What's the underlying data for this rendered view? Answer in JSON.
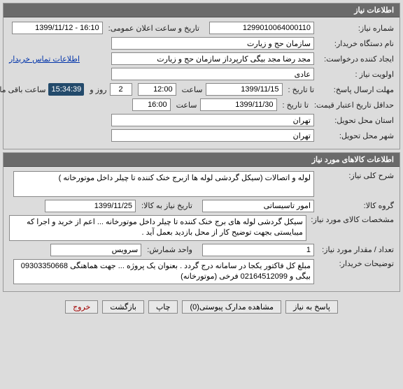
{
  "panel1": {
    "title": "اطلاعات نیاز",
    "need_no_label": "شماره نیاز:",
    "need_no": "1299010064000110",
    "announce_label": "تاریخ و ساعت اعلان عمومی:",
    "announce_val": "16:10 - 1399/11/12",
    "org_label": "نام دستگاه خریدار:",
    "org_val": "سازمان حج و زیارت",
    "creator_label": "ایجاد کننده درخواست:",
    "creator_val": "مجد رضا مجد بیگی کارپرداز سازمان حج و زیارت",
    "contact_link": "اطلاعات تماس خریدار",
    "priority_label": "اولویت نیاز :",
    "priority_val": "عادی",
    "deadline_label": "مهلت ارسال پاسخ:",
    "deadline_sub": "تا تاریخ :",
    "deadline_date": "1399/11/15",
    "hour_label": "ساعت",
    "deadline_time": "12:00",
    "days_val": "2",
    "days_label": "روز و",
    "countdown": "15:34:39",
    "countdown_after": "ساعت باقی مانده",
    "validity_label": "حداقل تاریخ اعتبار قیمت:",
    "validity_sub": "تا تاریخ :",
    "validity_date": "1399/11/30",
    "validity_time": "16:00",
    "province_label": "استان محل تحویل:",
    "province_val": "تهران",
    "city_label": "شهر محل تحویل:",
    "city_val": "تهران"
  },
  "panel2": {
    "title": "اطلاعات کالاهای مورد نیاز",
    "main_desc_label": "شرح کلی نیاز:",
    "main_desc_val": "لوله و اتصالات (سیکل گردشی لوله ها ازبرج خنک کننده تا چیلر داخل موتورخانه )",
    "group_label": "گروه کالا:",
    "group_val": "امور تاسیساتی",
    "req_date_label": "تاریخ نیاز به کالا:",
    "req_date_val": "1399/11/25",
    "item_desc_label": "مشخصات کالای مورد نیاز:",
    "item_desc_val": "سیکل گردشی لوله های برج خنک کننده تا چیلر داخل موتورخانه ... اعم از خرید و اجرا که میبایستی بجهت توضیح کار از محل بازدید بعمل آید .",
    "qty_label": "تعداد / مقدار مورد نیاز:",
    "qty_val": "1",
    "unit_label": "واحد شمارش:",
    "unit_val": "سرویس",
    "buyer_notes_label": "توضیحات خریدار:",
    "buyer_notes_val": "مبلغ کل فاکتور یکجا در سامانه درج گردد . بعنوان یک پروژه ... جهت هماهنگی 09303350668 بیگی و 02164512099 فرخی (موتورخانه)"
  },
  "buttons": {
    "reply": "پاسخ به نیاز",
    "attach": "مشاهده مدارک پیوستی(0)",
    "print": "چاپ",
    "back": "بازگشت",
    "exit": "خروج"
  }
}
